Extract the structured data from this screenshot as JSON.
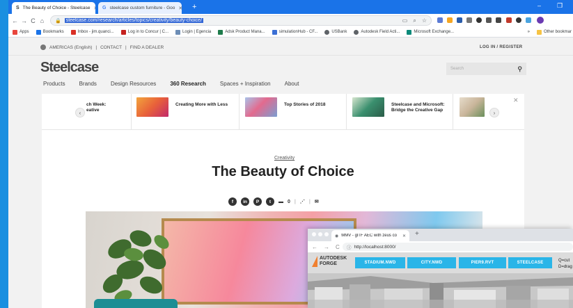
{
  "browser": {
    "tabs": [
      {
        "title": "The Beauty of Choice - Steelcase",
        "favicon": "S",
        "active": true
      },
      {
        "title": "steelcase custom furniture - Goo",
        "favicon": "G",
        "active": false
      }
    ],
    "new_tab": "+",
    "window_controls": {
      "minimize": "–",
      "restore": "❐"
    },
    "nav": {
      "back": "←",
      "forward": "→",
      "reload": "C",
      "home": "⌂"
    },
    "url": "steelcase.com/research/articles/topics/creativity/beauty-choice/",
    "bookmarks": [
      {
        "label": "Apps",
        "color": "#e8453c"
      },
      {
        "label": "Bookmarks",
        "color": "#1a73e8"
      },
      {
        "label": "Inbox - jim.quanci...",
        "color": "#d93025"
      },
      {
        "label": "Log in to Concur | C...",
        "color": "#c5221f"
      },
      {
        "label": "Login | Egencia",
        "color": "#6d8eb6"
      },
      {
        "label": "Adsk Product Mana...",
        "color": "#1e7b4b"
      },
      {
        "label": "simulationHub - CF...",
        "color": "#3b6fd4"
      },
      {
        "label": "USBank",
        "color": "#5f6368"
      },
      {
        "label": "Autodesk Field Acti...",
        "color": "#5f6368"
      },
      {
        "label": "Microsoft Exchange...",
        "color": "#0b8a7a"
      }
    ],
    "bookmarks_overflow": "»",
    "other_bookmarks": "Other bookmar"
  },
  "site": {
    "utility": {
      "region": "AMERICAS (English)",
      "contact": "CONTACT",
      "dealer": "FIND A DEALER",
      "login": "LOG IN / REGISTER"
    },
    "logo": "Steelcase",
    "search_placeholder": "Search",
    "nav": [
      "Products",
      "Brands",
      "Design Resources",
      "360 Research",
      "Spaces + Inspiration",
      "About"
    ],
    "carousel": [
      {
        "text": "ch Week:\neative",
        "color": "#9aa0a6"
      },
      {
        "text": "Creating More with Less",
        "color": "#e8613a"
      },
      {
        "text": "Top Stories of 2018",
        "color": "#7a9ed2"
      },
      {
        "text": "Steelcase and Microsoft: Bridge the Creative Gap",
        "color": "#3a8f6e"
      },
      {
        "text": "",
        "color": "#c9b59a"
      }
    ],
    "kicker": "Creativity",
    "title": "The Beauty of Choice",
    "share": {
      "comments": "0"
    }
  },
  "overlay_window": {
    "tab_title": "MMV - glTF AEC with zeus co",
    "url": "http://localhost:8000/",
    "logo_line1": "AUTODESK",
    "logo_line2": "FORGE",
    "buttons": [
      "STADIUM.NWD",
      "CITY.NWD",
      "PIER9.RVT",
      "STEELCASE"
    ],
    "help_lines": [
      "Q=cut",
      "D=drag"
    ]
  }
}
